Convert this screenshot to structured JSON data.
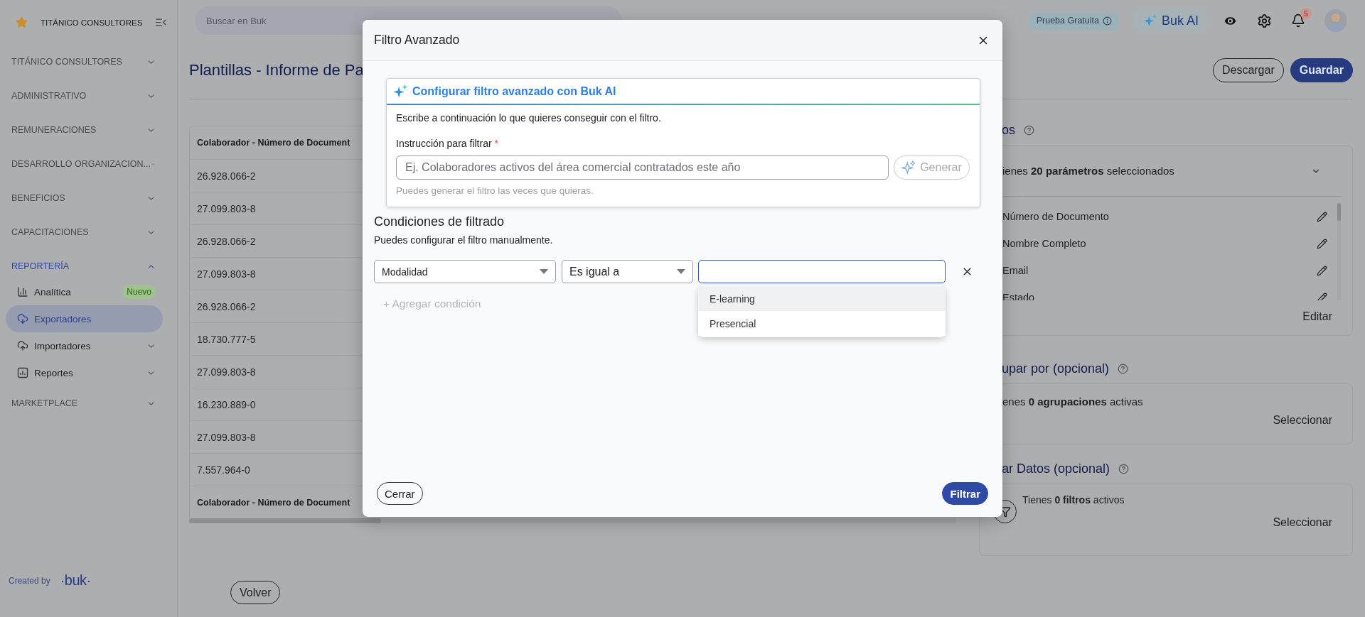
{
  "sidebar": {
    "company": "TITÁNICO CONSULTORES",
    "items": [
      {
        "label": "TITÁNICO CONSULTORES",
        "expanded": false
      },
      {
        "label": "ADMINISTRATIVO",
        "expanded": false
      },
      {
        "label": "REMUNERACIONES",
        "expanded": false
      },
      {
        "label": "DESARROLLO ORGANIZACION...",
        "expanded": false
      },
      {
        "label": "BENEFICIOS",
        "expanded": false
      },
      {
        "label": "CAPACITACIONES",
        "expanded": false
      },
      {
        "label": "REPORTERÍA",
        "expanded": true,
        "children": [
          {
            "label": "Analítica",
            "selected": false,
            "badge": "Nuevo"
          },
          {
            "label": "Exportadores",
            "selected": true
          },
          {
            "label": "Importadores",
            "selected": false,
            "expanded": false
          },
          {
            "label": "Reportes",
            "selected": false,
            "expanded": false
          }
        ]
      },
      {
        "label": "MARKETPLACE",
        "expanded": false
      }
    ],
    "footer": {
      "text": "Created by",
      "logo": "·buk·"
    }
  },
  "topbar": {
    "search": {
      "placeholder": "Buscar en Buk"
    },
    "trial_badge": "Prueba Gratuita",
    "ai_button": "Buk AI",
    "notifications": "5"
  },
  "page": {
    "title": "Plantillas - Informe de Pa",
    "buttons": [
      {
        "label": "Descargar",
        "kind": "outline"
      },
      {
        "label": "Guardar",
        "kind": "primary"
      }
    ],
    "table": {
      "columns": [
        "Colaborador - Número de Document"
      ],
      "rows": [
        "26.928.066-2",
        "27.099.803-8",
        "26.928.066-2",
        "27.099.803-8",
        "26.928.066-2",
        "18.730.777-5",
        "27.099.803-8",
        "16.230.889-0",
        "27.099.803-8",
        "7.557.964-0"
      ],
      "footer": "Colaborador - Número de Document"
    },
    "back_button": "Volver",
    "panels": [
      {
        "kind": "list",
        "title": "os",
        "summary": "ienes **20 parámetros** seleccionados",
        "fields": [
          "Número de Documento",
          "Nombre Completo",
          "Email",
          "Estado"
        ],
        "action": "Editar"
      },
      {
        "kind": "plain",
        "title": "upar por (opcional)",
        "summary": "enes **0 agrupaciones** activas",
        "action": "Seleccionar"
      },
      {
        "kind": "filter",
        "title": "ar Datos (opcional)",
        "summary": "Tienes **0 filtros** activos",
        "action": "Seleccionar"
      }
    ]
  },
  "modal": {
    "title": "Filtro Avanzado",
    "ai": {
      "title": "Configurar filtro avanzado con Buk AI",
      "description": "Escribe a continuación lo que quieres conseguir con el filtro.",
      "label": "Instrucción para filtrar",
      "required_mark": "*",
      "placeholder": "Ej. Colaboradores activos del área comercial contratados este año",
      "button": {
        "label": "Generar",
        "disabled": true
      },
      "hint": "Puedes generar el filtro las veces que quieras."
    },
    "conditions": {
      "title": "Condiciones de filtrado",
      "description": "Puedes configurar el filtro manualmente.",
      "rows": [
        {
          "field": "Modalidad",
          "operator": "Es igual a",
          "focused": true,
          "open": true,
          "options": [
            {
              "label": "E-learning",
              "selected": true
            },
            {
              "label": "Presencial",
              "selected": false
            }
          ]
        }
      ],
      "add_button": "+ Agregar condición"
    },
    "buttons": [
      {
        "label": "Cerrar",
        "kind": "outline"
      },
      {
        "label": "Filtrar",
        "kind": "primary"
      }
    ]
  }
}
